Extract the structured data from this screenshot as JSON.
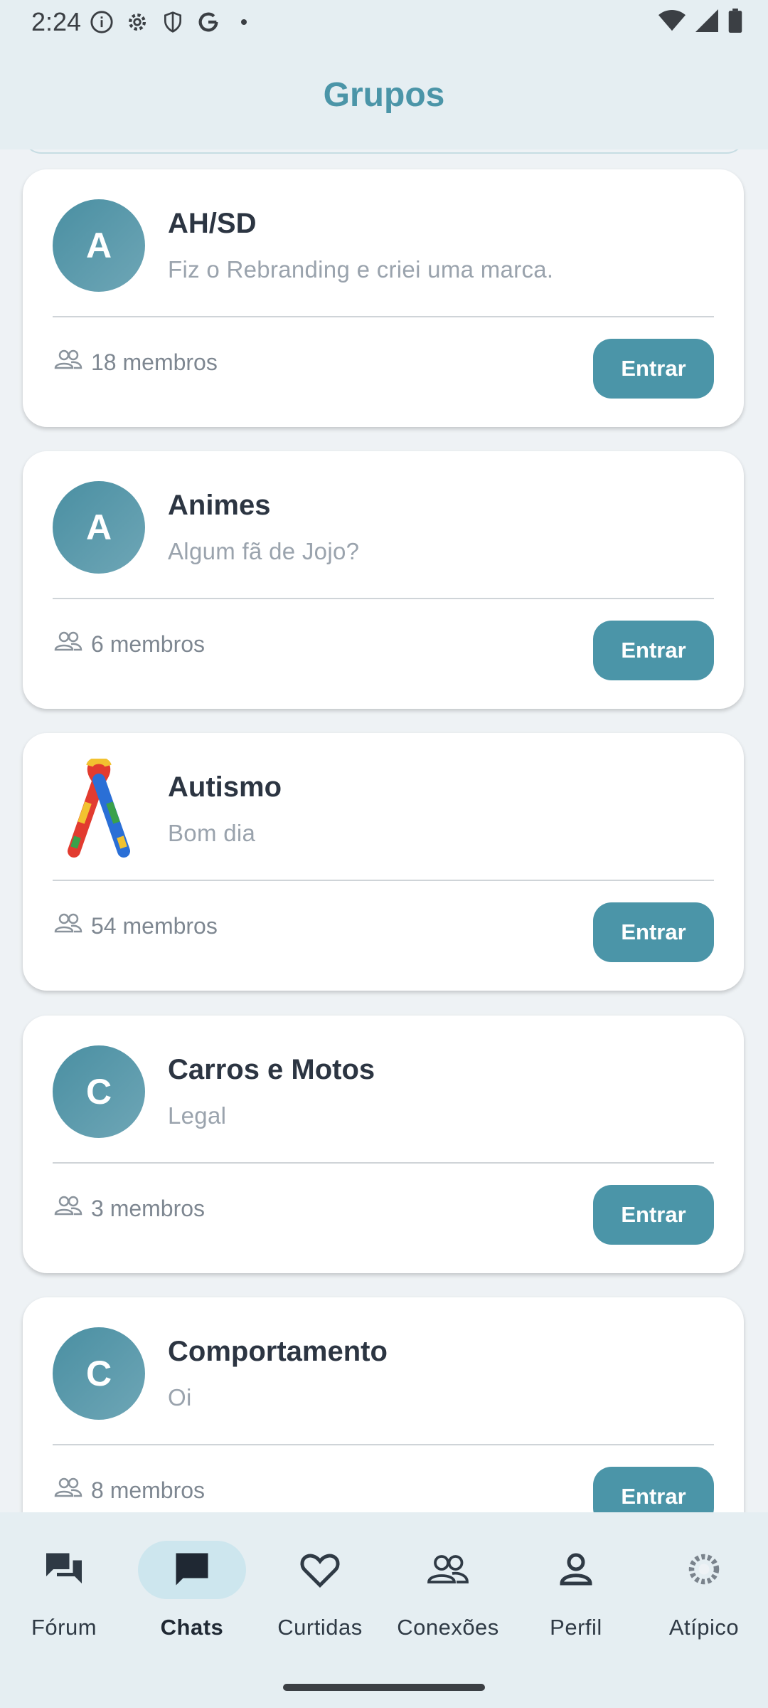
{
  "status_bar": {
    "time": "2:24",
    "icons_left": [
      "info-icon",
      "gear-icon",
      "shield-icon",
      "google-icon",
      "dot-icon"
    ],
    "icons_right": [
      "wifi-icon",
      "signal-icon",
      "battery-icon"
    ]
  },
  "header": {
    "title": "Grupos"
  },
  "groups": [
    {
      "initial": "A",
      "name": "AH/SD",
      "last_message": "Fiz o Rebranding e criei uma marca.",
      "members": "18 membros",
      "button": "Entrar"
    },
    {
      "initial": "A",
      "name": "Animes",
      "last_message": "Algum fã de Jojo?",
      "members": "6 membros",
      "button": "Entrar"
    },
    {
      "initial": "",
      "image": "autism-ribbon",
      "name": "Autismo",
      "last_message": "Bom dia",
      "members": "54 membros",
      "button": "Entrar"
    },
    {
      "initial": "C",
      "name": "Carros e Motos",
      "last_message": "Legal",
      "members": "3 membros",
      "button": "Entrar"
    },
    {
      "initial": "C",
      "name": "Comportamento",
      "last_message": "Oi",
      "members": "8 membros",
      "button": "Entrar"
    }
  ],
  "bottom_nav": {
    "active": "Chats",
    "items": [
      {
        "label": "Fórum",
        "icon": "forum-icon"
      },
      {
        "label": "Chats",
        "icon": "chat-icon"
      },
      {
        "label": "Curtidas",
        "icon": "heart-icon"
      },
      {
        "label": "Conexões",
        "icon": "people-icon"
      },
      {
        "label": "Perfil",
        "icon": "person-icon"
      },
      {
        "label": "Atípico",
        "icon": "atipico-logo-icon"
      }
    ]
  },
  "colors": {
    "accent": "#4b95a8",
    "header_bg": "#e5eef2",
    "page_bg": "#eef2f5",
    "active_nav_pill": "#cde6ee"
  }
}
